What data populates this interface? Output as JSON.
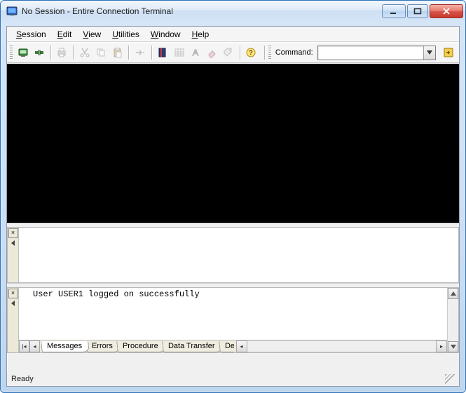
{
  "window": {
    "title": "No Session - Entire Connection Terminal"
  },
  "menu": {
    "items": [
      {
        "label": "Session",
        "accel": "S"
      },
      {
        "label": "Edit",
        "accel": "E"
      },
      {
        "label": "View",
        "accel": "V"
      },
      {
        "label": "Utilities",
        "accel": "U"
      },
      {
        "label": "Window",
        "accel": "W"
      },
      {
        "label": "Help",
        "accel": "H"
      }
    ]
  },
  "toolbar": {
    "command_label": "Command:",
    "command_value": ""
  },
  "output_panel": {
    "message": "User USER1 logged on successfully"
  },
  "tabs": {
    "items": [
      "Messages",
      "Errors",
      "Procedure",
      "Data Transfer",
      "De"
    ],
    "active_index": 0
  },
  "status": {
    "text": "Ready"
  },
  "icons": {
    "minimize": "minimize",
    "maximize": "maximize",
    "close": "close"
  }
}
